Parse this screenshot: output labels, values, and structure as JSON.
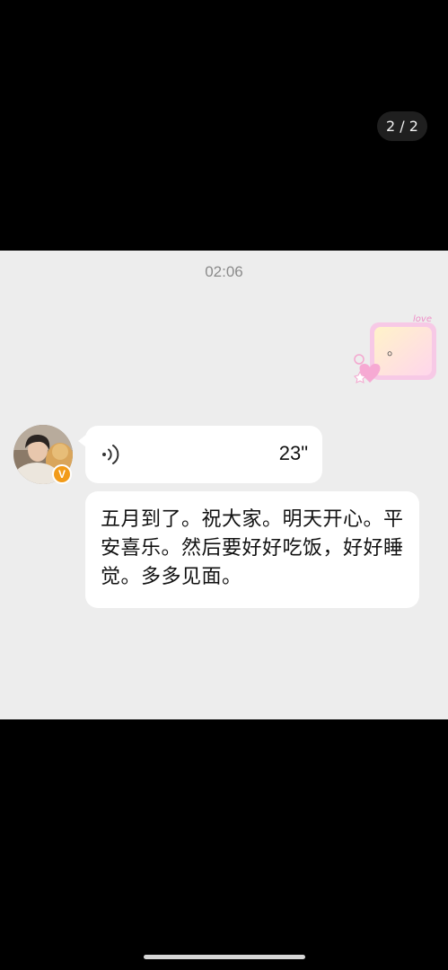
{
  "viewer": {
    "page_counter": "2 / 2"
  },
  "chat": {
    "timestamp": "02:06",
    "sticker": {
      "text": "love",
      "content": "。"
    },
    "sender": {
      "badge": "V"
    },
    "voice_message": {
      "duration": "23\""
    },
    "text_message": "五月到了。祝大家。明天开心。平安喜乐。然后要好好吃饭，好好睡觉。多多见面。"
  },
  "colors": {
    "background": "#000000",
    "chat_background": "#ededed",
    "bubble": "#ffffff",
    "verified_badge": "#f29b19"
  }
}
